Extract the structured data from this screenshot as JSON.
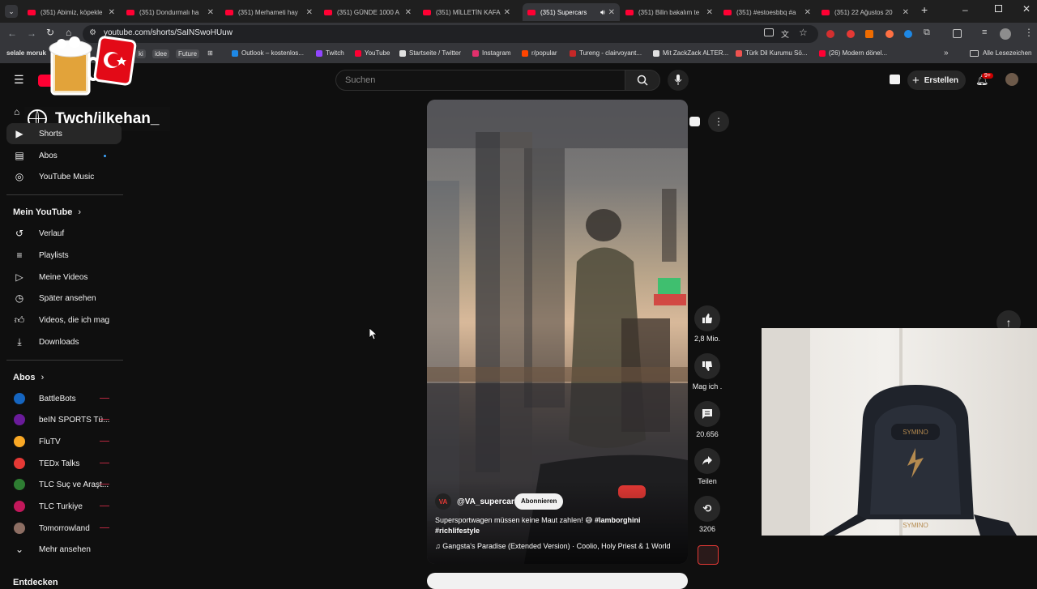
{
  "tabs": [
    {
      "title": "(351) Abimiz, köpekle",
      "active": false
    },
    {
      "title": "(351) Dondurmalı ha",
      "active": false
    },
    {
      "title": "(351) Merhameti hay",
      "active": false
    },
    {
      "title": "(351) GÜNDE 1000 A",
      "active": false
    },
    {
      "title": "(351) MİLLETİN KAFA",
      "active": false
    },
    {
      "title": "(351) Supercars",
      "active": true
    },
    {
      "title": "(351) Bilin bakalım te",
      "active": false
    },
    {
      "title": "(351) #estoesbbq #a",
      "active": false
    },
    {
      "title": "(351) 22 Ağustos 20",
      "active": false
    }
  ],
  "address": {
    "url": "youtube.com/shorts/SaINSwoHUuw"
  },
  "bookmarks": [
    {
      "label": "selale moruk",
      "color": "#8bc34a"
    },
    {
      "label": "ki",
      "color": "#9e9e9e"
    },
    {
      "label": "idee",
      "color": "#9e9e9e"
    },
    {
      "label": "Future",
      "color": "#9e9e9e"
    },
    {
      "label": "Outlook – kostenlos...",
      "color": "#1e88e5"
    },
    {
      "label": "Twitch",
      "color": "#9146ff"
    },
    {
      "label": "YouTube",
      "color": "#ff0033"
    },
    {
      "label": "Startseite / Twitter",
      "color": "#e0e0e0"
    },
    {
      "label": "Instagram",
      "color": "#e1306c"
    },
    {
      "label": "r/popular",
      "color": "#ff4500"
    },
    {
      "label": "Tureng - clairvoyant...",
      "color": "#c62828"
    },
    {
      "label": "Mit ZackZack ALTER...",
      "color": "#e0e0e0"
    },
    {
      "label": "Türk Dil Kurumu Sö...",
      "color": "#ef5350"
    },
    {
      "label": "(26) Modern dönel...",
      "color": "#ff0033"
    }
  ],
  "all_bookmarks": "Alle Lesezeichen",
  "overlay": {
    "twitch_handle": "Twch/ilkehan_"
  },
  "search": {
    "placeholder": "Suchen"
  },
  "header": {
    "create_label": "Erstellen",
    "notif_count": "9+"
  },
  "sidebar": {
    "top": [
      {
        "label": "Shorts"
      },
      {
        "label": "Abos"
      },
      {
        "label": "YouTube Music"
      }
    ],
    "my_youtube_title": "Mein YouTube",
    "my_youtube": [
      {
        "label": "Verlauf"
      },
      {
        "label": "Playlists"
      },
      {
        "label": "Meine Videos"
      },
      {
        "label": "Später ansehen"
      },
      {
        "label": "Videos, die ich mag"
      },
      {
        "label": "Downloads"
      }
    ],
    "subs_title": "Abos",
    "subs": [
      {
        "label": "BattleBots",
        "color": "#1565c0"
      },
      {
        "label": "beIN SPORTS Tü...",
        "color": "#6a1b9a"
      },
      {
        "label": "FluTV",
        "color": "#f9a825"
      },
      {
        "label": "TEDx Talks",
        "color": "#e53935"
      },
      {
        "label": "TLC Suç ve Araşt...",
        "color": "#2e7d32"
      },
      {
        "label": "TLC Turkiye",
        "color": "#c2185b"
      },
      {
        "label": "Tomorrowland",
        "color": "#8d6e63"
      }
    ],
    "more_label": "Mehr ansehen",
    "explore_label": "Entdecken"
  },
  "short": {
    "channel": "@VA_supercars",
    "subscribe_label": "Abonnieren",
    "caption_text": "Supersportwagen müssen keine Maut zahlen! 😅 ",
    "caption_tag1": "#lamborghini",
    "caption_tag2": "#richlifestyle",
    "music": "Gangsta's Paradise (Extended Version) · Coolio, Holy Priest & 1 World"
  },
  "actions": {
    "likes": "2,8 Mio.",
    "dislike_label": "Mag ich .",
    "comments": "20.656",
    "share_label": "Teilen",
    "remix_count": "3206"
  },
  "webcam": {
    "chair_brand": "SYMINO"
  }
}
